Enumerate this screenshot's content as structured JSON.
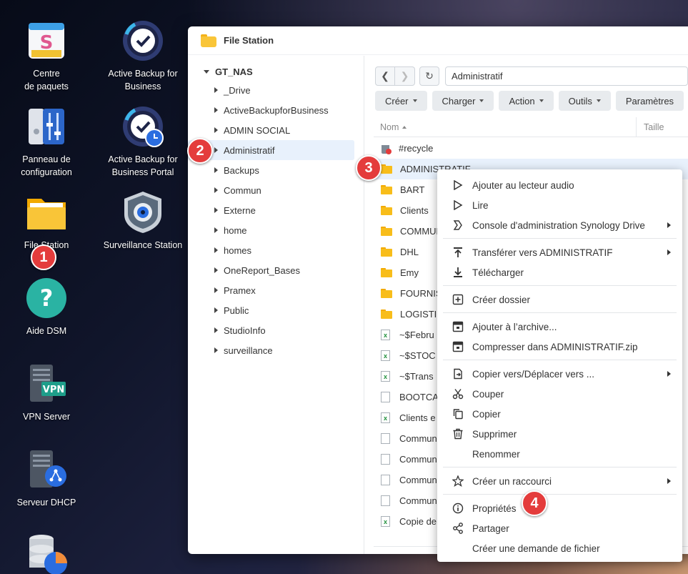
{
  "desktop": {
    "icons": [
      {
        "label": "Centre\nde paquets",
        "l1": "Centre",
        "l2": "de paquets"
      },
      {
        "l1": "Active Backup for",
        "l2": "Business"
      },
      {
        "l1": "Panneau de",
        "l2": "configuration"
      },
      {
        "l1": "Active Backup for",
        "l2": "Business Portal"
      },
      {
        "l1": "File Station"
      },
      {
        "l1": "Surveillance Station"
      },
      {
        "l1": "Aide DSM"
      },
      {
        "l1": "VPN Server",
        "tag": "VPN"
      },
      {
        "l1": "Serveur DHCP"
      }
    ]
  },
  "badges": [
    "1",
    "2",
    "3",
    "4"
  ],
  "window": {
    "title": "File Station",
    "tree": {
      "root": "GT_NAS",
      "nodes": [
        "_Drive",
        "ActiveBackupforBusiness",
        "ADMIN SOCIAL",
        "Administratif",
        "Backups",
        "Commun",
        "Externe",
        "home",
        "homes",
        "OneReport_Bases",
        "Pramex",
        "Public",
        "StudioInfo",
        "surveillance"
      ]
    },
    "path": "Administratif",
    "toolbar": [
      "Créer",
      "Charger",
      "Action",
      "Outils",
      "Paramètres"
    ],
    "columns": {
      "name": "Nom",
      "size": "Taille"
    },
    "rows": [
      {
        "type": "trash",
        "name": "#recycle"
      },
      {
        "type": "folder",
        "name": "ADMINISTRATIF"
      },
      {
        "type": "folder",
        "name": "BART"
      },
      {
        "type": "folder",
        "name": "Clients"
      },
      {
        "type": "folder",
        "name": "COMMUN"
      },
      {
        "type": "folder",
        "name": "DHL"
      },
      {
        "type": "folder",
        "name": "Emy"
      },
      {
        "type": "folder",
        "name": "FOURNIS"
      },
      {
        "type": "folder",
        "name": "LOGISTI"
      },
      {
        "type": "xls",
        "name": "~$Febru"
      },
      {
        "type": "xls",
        "name": "~$STOC"
      },
      {
        "type": "xls",
        "name": "~$Trans"
      },
      {
        "type": "doc",
        "name": "BOOTCA"
      },
      {
        "type": "xls",
        "name": "Clients e"
      },
      {
        "type": "doc",
        "name": "Commun"
      },
      {
        "type": "doc",
        "name": "Commun"
      },
      {
        "type": "doc",
        "name": "Commun"
      },
      {
        "type": "doc",
        "name": "Commun"
      },
      {
        "type": "xls",
        "name": "Copie de"
      }
    ]
  },
  "context_menu": {
    "groups": [
      [
        {
          "icon": "play-icon",
          "label": "Ajouter au lecteur audio"
        },
        {
          "icon": "play-icon",
          "label": "Lire"
        },
        {
          "icon": "synology-drive-icon",
          "label": "Console d'administration Synology Drive",
          "submenu": true
        }
      ],
      [
        {
          "icon": "upload-icon",
          "label": "Transférer vers ADMINISTRATIF",
          "submenu": true
        },
        {
          "icon": "download-icon",
          "label": "Télécharger"
        }
      ],
      [
        {
          "icon": "new-folder-icon",
          "label": "Créer dossier"
        }
      ],
      [
        {
          "icon": "archive-icon",
          "label": "Ajouter à l’archive..."
        },
        {
          "icon": "archive-icon",
          "label": "Compresser dans ADMINISTRATIF.zip"
        }
      ],
      [
        {
          "icon": "copy-move-icon",
          "label": "Copier vers/Déplacer vers ...",
          "submenu": true
        },
        {
          "icon": "scissors-icon",
          "label": "Couper"
        },
        {
          "icon": "copy-icon",
          "label": "Copier"
        },
        {
          "icon": "trash-icon",
          "label": "Supprimer"
        },
        {
          "icon": "",
          "label": "Renommer"
        }
      ],
      [
        {
          "icon": "star-icon",
          "label": "Créer un raccourci",
          "submenu": true
        }
      ],
      [
        {
          "icon": "info-icon",
          "label": "Propriétés"
        },
        {
          "icon": "share-icon",
          "label": "Partager"
        },
        {
          "icon": "",
          "label": "Créer une demande de fichier"
        }
      ]
    ]
  }
}
